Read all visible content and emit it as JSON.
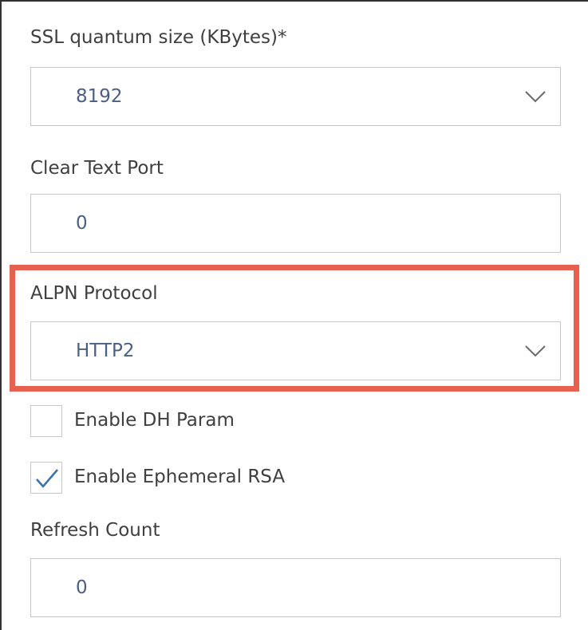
{
  "fields": {
    "ssl_quantum": {
      "label": "SSL quantum size (KBytes)*",
      "value": "8192",
      "icon": "chevron-down-icon"
    },
    "clear_text_port": {
      "label": "Clear Text Port",
      "value": "0"
    },
    "alpn_protocol": {
      "label": "ALPN Protocol",
      "value": "HTTP2",
      "icon": "chevron-down-icon"
    },
    "enable_dh_param": {
      "label": "Enable DH Param",
      "checked": false
    },
    "enable_ephemeral_rsa": {
      "label": "Enable Ephemeral RSA",
      "checked": true,
      "icon": "checkmark-icon"
    },
    "refresh_count": {
      "label": "Refresh Count",
      "value": "0"
    }
  },
  "colors": {
    "highlight": "#e8604f",
    "value_text": "#4b5f86",
    "border": "#c8c8c8",
    "check": "#3a6fb0"
  }
}
